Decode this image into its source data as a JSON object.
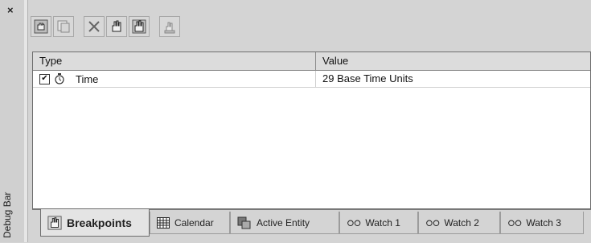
{
  "panel": {
    "title": "Debug Bar",
    "close_label": "×"
  },
  "toolbar": {
    "buttons": [
      {
        "icon": "breakpoint-add-icon"
      },
      {
        "icon": "breakpoint-copy-icon"
      },
      {
        "icon": "delete-icon"
      },
      {
        "icon": "breakpoint-enable-icon"
      },
      {
        "icon": "breakpoint-disable-icon"
      },
      {
        "icon": "breakpoint-properties-icon"
      }
    ]
  },
  "grid": {
    "columns": [
      "Type",
      "Value"
    ],
    "rows": [
      {
        "checked": true,
        "checkmark": "✔",
        "type": "Time",
        "value": "29 Base Time Units"
      }
    ]
  },
  "tabs": [
    {
      "label": "Breakpoints",
      "icon": "breakpoint-icon",
      "active": true
    },
    {
      "label": "Calendar",
      "icon": "calendar-icon",
      "active": false
    },
    {
      "label": "Active Entity",
      "icon": "active-entity-icon",
      "active": false
    },
    {
      "label": "Watch 1",
      "icon": "glasses-icon",
      "active": false
    },
    {
      "label": "Watch 2",
      "icon": "glasses-icon",
      "active": false
    },
    {
      "label": "Watch 3",
      "icon": "glasses-icon",
      "active": false
    }
  ],
  "colors": {
    "background": "#d4d4d4",
    "grid_background": "#ffffff",
    "header_background": "#dcdcdc"
  }
}
